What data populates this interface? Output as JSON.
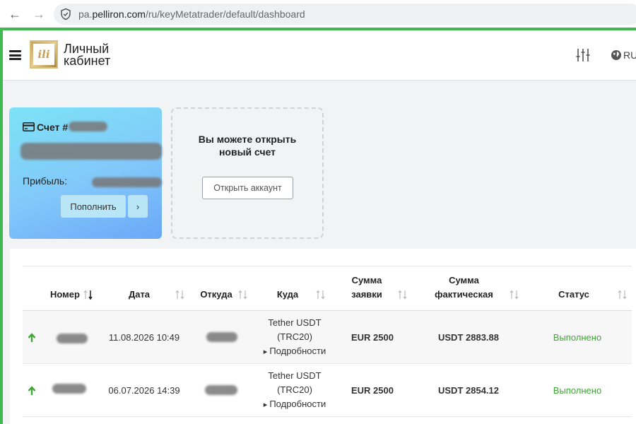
{
  "browser": {
    "url_prefix": "pa.",
    "url_domain": "pelliron.com",
    "url_path": "/ru/keyMetatrader/default/dashboard"
  },
  "header": {
    "brand_line1": "Личный",
    "brand_line2": "кабинет",
    "language": "RU"
  },
  "account_card": {
    "label": "Счет #",
    "profit_label": "Прибыль:",
    "topup_button": "Пополнить",
    "more_button": "›"
  },
  "new_account": {
    "text_line1": "Вы можете открыть",
    "text_line2": "новый счет",
    "open_button": "Открыть аккаунт"
  },
  "table": {
    "columns": [
      {
        "label": "Номер",
        "sorted": "desc"
      },
      {
        "label": "Дата"
      },
      {
        "label": "Откуда"
      },
      {
        "label": "Куда"
      },
      {
        "label_line1": "Сумма",
        "label_line2": "заявки"
      },
      {
        "label_line1": "Сумма",
        "label_line2": "фактическая"
      },
      {
        "label": "Статус"
      }
    ],
    "rows": [
      {
        "date": "11.08.2026 10:49",
        "to_line1": "Tether USDT",
        "to_line2": "(TRC20)",
        "details": "Подробности",
        "request_amount": "EUR 2500",
        "actual_amount": "USDT 2883.88",
        "status": "Выполнено"
      },
      {
        "date": "06.07.2026 14:39",
        "to_line1": "Tether USDT",
        "to_line2": "(TRC20)",
        "details": "Подробности",
        "request_amount": "EUR 2500",
        "actual_amount": "USDT 2854.12",
        "status": "Выполнено"
      }
    ]
  },
  "colors": {
    "accent_green": "#3fb950",
    "status_green": "#3fa535",
    "card_gradient_start": "#7de3f6",
    "card_gradient_end": "#6aa8f8"
  },
  "icons": {
    "back": "arrow-left-icon",
    "forward": "arrow-right-icon",
    "secure": "shield-check-icon",
    "menu": "hamburger-icon",
    "filters": "sliders-icon",
    "language": "globe-icon",
    "card": "credit-card-icon",
    "row_direction": "arrow-up-icon"
  }
}
